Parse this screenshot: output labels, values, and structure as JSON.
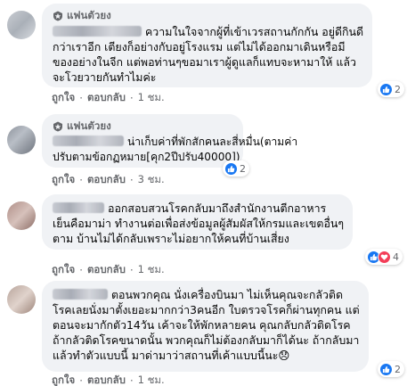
{
  "comments": [
    {
      "badge": "แฟนตัวยง",
      "lines": [
        "ความในใจจากผู้ที่เข้าเวรสถานกักกัน อยู่ดีกินดี",
        "กว่าเราอีก เตียงก็อย่างกับอยู่โรงแรม แต่ไม่ได้ออกมาเดินหรือมี",
        "ของอย่างในจีก แต่พอท่านๆขอมาเราผู้ดูแลก็แทบจะหามาให้ แล้ว",
        "จะโวยวายกันทำไมค่ะ"
      ],
      "like": "ถูกใจ",
      "reply": "ตอบกลับ",
      "time": "1 ชม.",
      "reaction_count": "2"
    },
    {
      "badge": "แฟนตัวยง",
      "lines": [
        "น่าเก็บค่าที่พักสักคนละสี่หมื่น(ตามค่า",
        "ปรับตามข้อกฏหมาย[คุก2ปีปรับ40000])"
      ],
      "like": "ถูกใจ",
      "reply": "ตอบกลับ",
      "time": "3 ชม.",
      "reaction_count": "2"
    },
    {
      "badge": "",
      "lines": [
        "ออกสอบสวนโรคกลับมาถึงสำนักงานตีกอาหาร",
        "เย็นคือมาม่า ทำงานต่อเพื่อส่งข้อมูลผู้สัมผัสให้กรมและเขตอื่นๆ",
        "ตาม บ้านไม่ได้กลับเพราะไม่อยากให้คนที่บ้านเสี่ยง"
      ],
      "like": "ถูกใจ",
      "reply": "ตอบกลับ",
      "time": "1 ชม.",
      "reaction_count": "4"
    },
    {
      "badge": "",
      "lines": [
        "ตอนพวกคุณ นั่งเครื่องบินมา ไม่เห็นคุณจะกลัวติด",
        "โรคเลยนั่งมาตั้งเยอะมากกว่า3คนอีก ใบตรวจโรคก็ผ่านทุกคน แต่",
        "ตอนจะมากักตัว14วัน เค้าจะให้พักหลายคน คุณกลับกลัวติดโรค",
        "ถ้ากลัวติดโรคขนาดนั้น พวกคุณก็ไม่ต้องกลับมาก็ได้นะ ถ้ากลับมา",
        "แล้วทำตัวแบบนี้ มาด่ามาว่าสถานที่เค้าแบบนี้นะ😞"
      ],
      "like": "ถูกใจ",
      "reply": "ตอบกลับ",
      "time": "1 ชม.",
      "reaction_count": "2"
    }
  ],
  "colors": {
    "bubble": "#f0f2f5",
    "meta": "#65676b",
    "like": "#1877f2",
    "love": "#f33e58"
  },
  "icons": [
    "fan-badge-icon",
    "like-reaction-icon",
    "love-reaction-icon",
    "more-options-icon"
  ]
}
